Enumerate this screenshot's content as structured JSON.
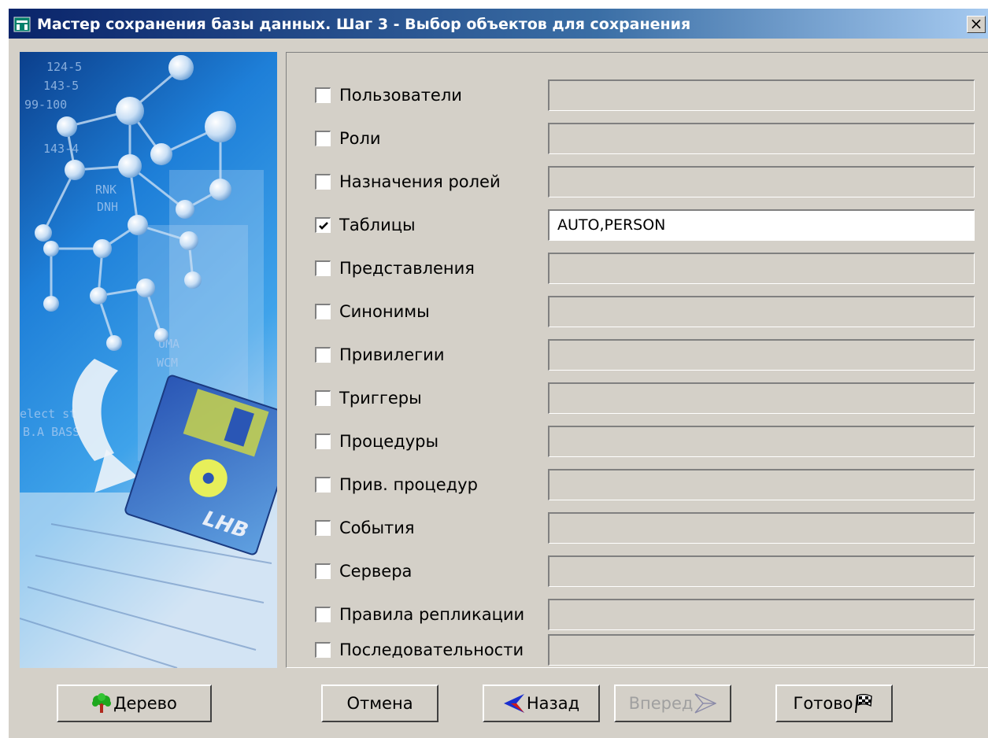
{
  "window": {
    "title": "Мастер сохранения базы данных. Шаг 3 - Выбор объектов для сохранения",
    "close_label": "×"
  },
  "objects": [
    {
      "label": "Пользователи",
      "checked": false,
      "value": ""
    },
    {
      "label": "Роли",
      "checked": false,
      "value": ""
    },
    {
      "label": "Назначения ролей",
      "checked": false,
      "value": ""
    },
    {
      "label": "Таблицы",
      "checked": true,
      "value": "AUTO,PERSON"
    },
    {
      "label": "Представления",
      "checked": false,
      "value": ""
    },
    {
      "label": "Синонимы",
      "checked": false,
      "value": ""
    },
    {
      "label": "Привилегии",
      "checked": false,
      "value": ""
    },
    {
      "label": "Триггеры",
      "checked": false,
      "value": ""
    },
    {
      "label": "Процедуры",
      "checked": false,
      "value": ""
    },
    {
      "label": "Прив. процедур",
      "checked": false,
      "value": ""
    },
    {
      "label": "События",
      "checked": false,
      "value": ""
    },
    {
      "label": "Сервера",
      "checked": false,
      "value": ""
    },
    {
      "label": "Правила репликации",
      "checked": false,
      "value": ""
    },
    {
      "label": "Последовательности",
      "checked": false,
      "value": ""
    }
  ],
  "buttons": {
    "tree": "Дерево",
    "cancel": "Отмена",
    "back": "Назад",
    "next": "Вперед",
    "finish": "Готово"
  },
  "art": {
    "labels": [
      "124-5",
      "143-5",
      "99-100",
      "143-4",
      "RNK",
      "DNH",
      "UMA",
      "WCM",
      "elect st",
      "B.A BASS",
      "LHB"
    ]
  },
  "icons": {
    "app": "database-app-icon",
    "tree": "tree-icon",
    "back": "back-arrow-icon",
    "next": "forward-arrow-icon",
    "finish": "checkered-flag-icon"
  },
  "colors": {
    "title_start": "#0a246a",
    "title_end": "#a6caf0",
    "face": "#d4d0c8",
    "art_blue": "#1e6fc4"
  }
}
